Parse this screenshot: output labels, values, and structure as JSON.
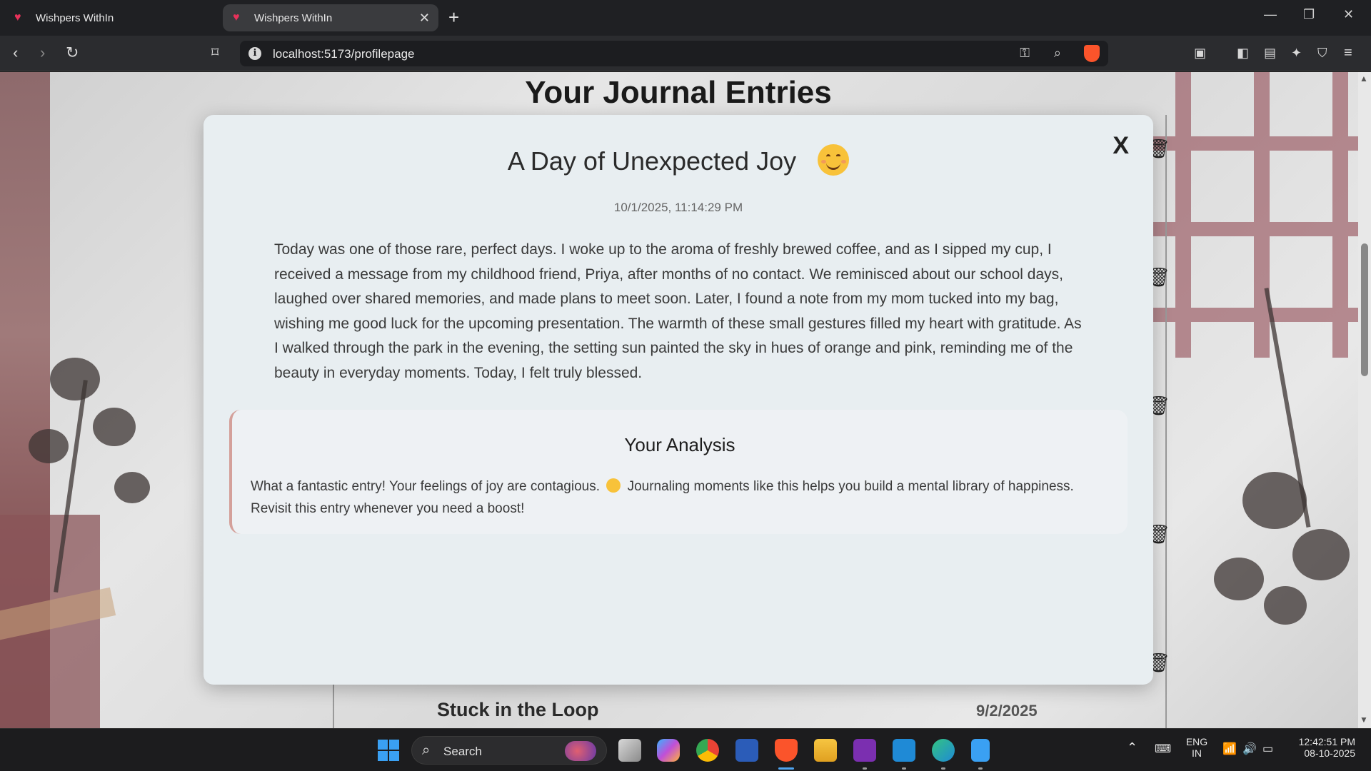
{
  "browser": {
    "tabs": [
      {
        "title": "Wishpers WithIn",
        "active": false
      },
      {
        "title": "Wishpers WithIn",
        "active": true
      }
    ],
    "url": "localhost:5173/profilepage"
  },
  "page": {
    "heading": "Your Journal Entries",
    "background_entry": {
      "title": "Stuck in the Loop",
      "date": "9/2/2025"
    }
  },
  "modal": {
    "close_label": "X",
    "title": "A Day of Unexpected Joy",
    "mood_emoji": "smiling-face-emoji",
    "timestamp": "10/1/2025, 11:14:29 PM",
    "body": "Today was one of those rare, perfect days. I woke up to the aroma of freshly brewed coffee, and as I sipped my cup, I received a message from my childhood friend, Priya, after months of no contact. We reminisced about our school days, laughed over shared memories, and made plans to meet soon. Later, I found a note from my mom tucked into my bag, wishing me good luck for the upcoming presentation. The warmth of these small gestures filled my heart with gratitude. As I walked through the park in the evening, the setting sun painted the sky in hues of orange and pink, reminding me of the beauty in everyday moments. Today, I felt truly blessed.",
    "analysis": {
      "title": "Your Analysis",
      "text_before": "What a fantastic entry! Your feelings of joy are contagious.",
      "text_after": "Journaling moments like this helps you build a mental library of happiness. Revisit this entry whenever you need a boost!"
    }
  },
  "taskbar": {
    "search_label": "Search",
    "language": "ENG",
    "region": "IN",
    "time": "12:42:51 PM",
    "date": "08-10-2025"
  },
  "colors": {
    "modal_bg": "#e8eef1",
    "analysis_accent": "#d4a09a",
    "brand_heart": "#e8315a"
  }
}
